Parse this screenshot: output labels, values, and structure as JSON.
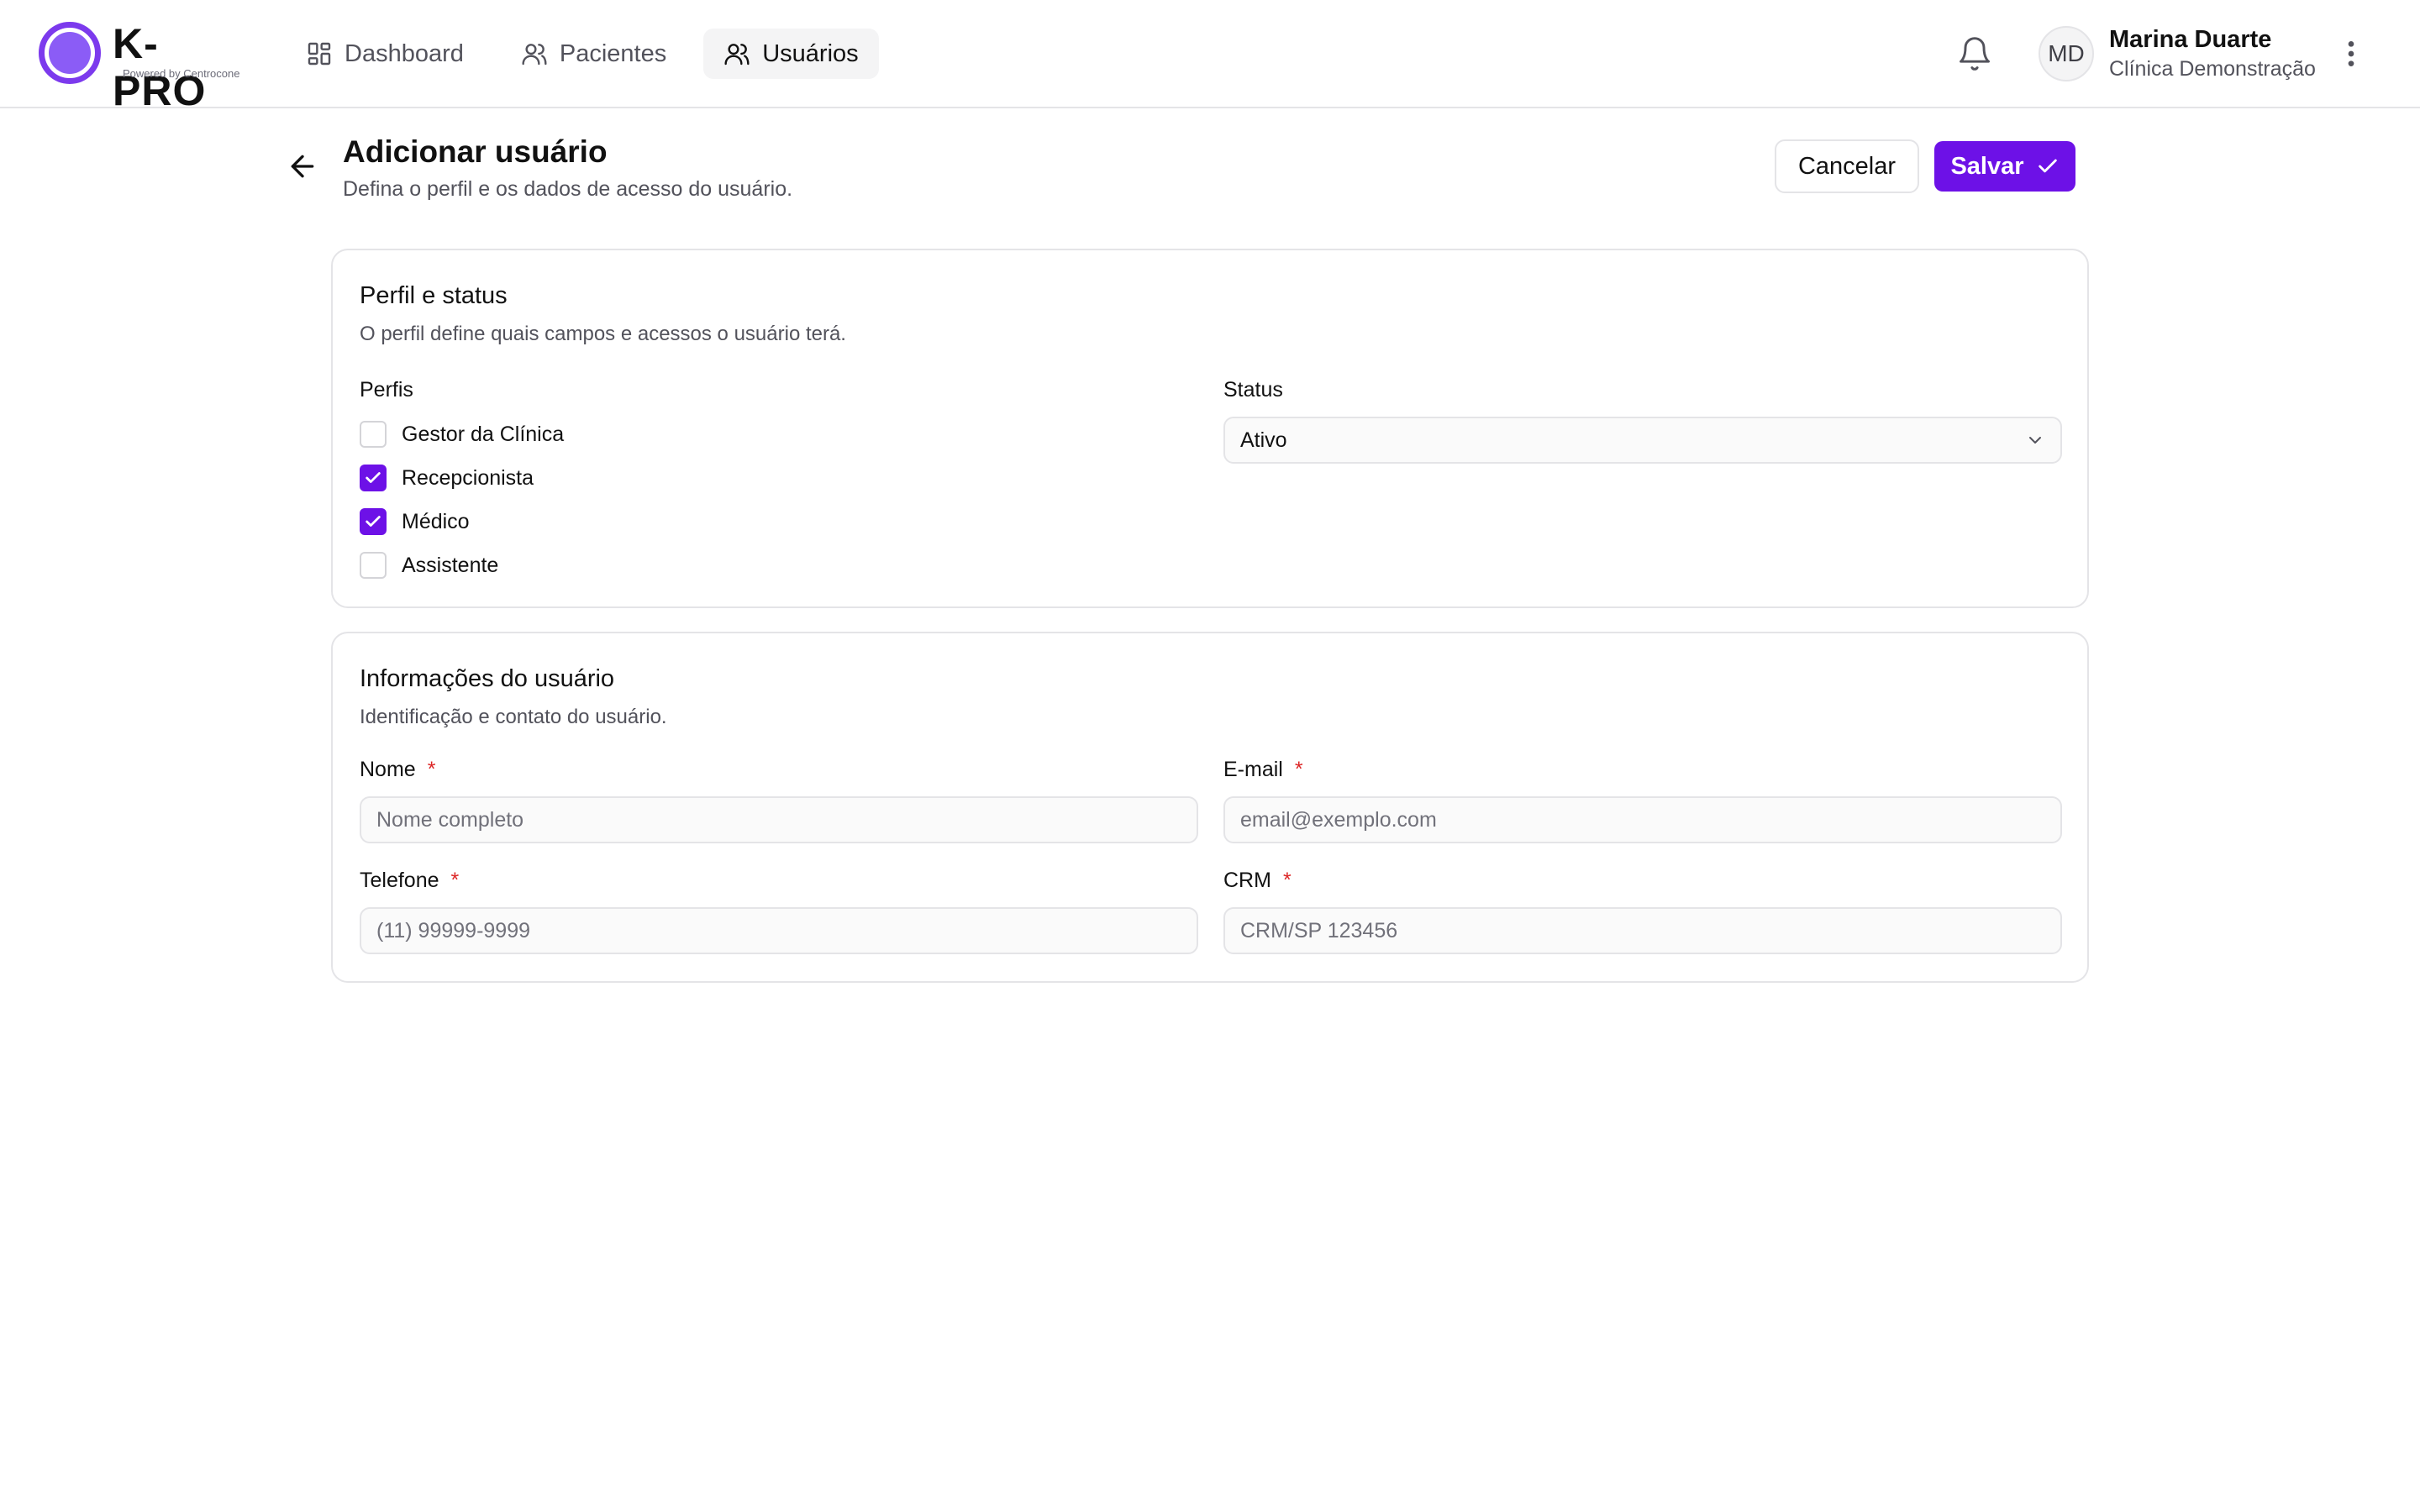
{
  "brand": {
    "name": "K-PRO",
    "tagline": "Powered by Centrocone",
    "accent_color": "#6d11e7"
  },
  "nav": {
    "items": [
      {
        "label": "Dashboard",
        "icon": "dashboard-icon",
        "active": false
      },
      {
        "label": "Pacientes",
        "icon": "users-icon",
        "active": false
      },
      {
        "label": "Usuários",
        "icon": "users-icon",
        "active": true
      }
    ]
  },
  "user": {
    "initials": "MD",
    "name": "Marina Duarte",
    "clinic": "Clínica Demonstração"
  },
  "header": {
    "title": "Adicionar usuário",
    "subtitle": "Defina o perfil e os dados de acesso do usuário.",
    "cancel_label": "Cancelar",
    "save_label": "Salvar"
  },
  "profile_card": {
    "title": "Perfil e status",
    "description": "O perfil define quais campos e acessos o usuário terá.",
    "profiles_label": "Perfis",
    "profiles": [
      {
        "label": "Gestor da Clínica",
        "checked": false
      },
      {
        "label": "Recepcionista",
        "checked": true
      },
      {
        "label": "Médico",
        "checked": true
      },
      {
        "label": "Assistente",
        "checked": false
      }
    ],
    "status_label": "Status",
    "status_value": "Ativo"
  },
  "info_card": {
    "title": "Informações do usuário",
    "description": "Identificação e contato do usuário.",
    "required_mark": "*",
    "fields": {
      "name": {
        "label": "Nome",
        "placeholder": "Nome completo",
        "value": ""
      },
      "email": {
        "label": "E-mail",
        "placeholder": "email@exemplo.com",
        "value": ""
      },
      "phone": {
        "label": "Telefone",
        "placeholder": "(11) 99999-9999",
        "value": ""
      },
      "crm": {
        "label": "CRM",
        "placeholder": "CRM/SP 123456",
        "value": ""
      }
    }
  }
}
